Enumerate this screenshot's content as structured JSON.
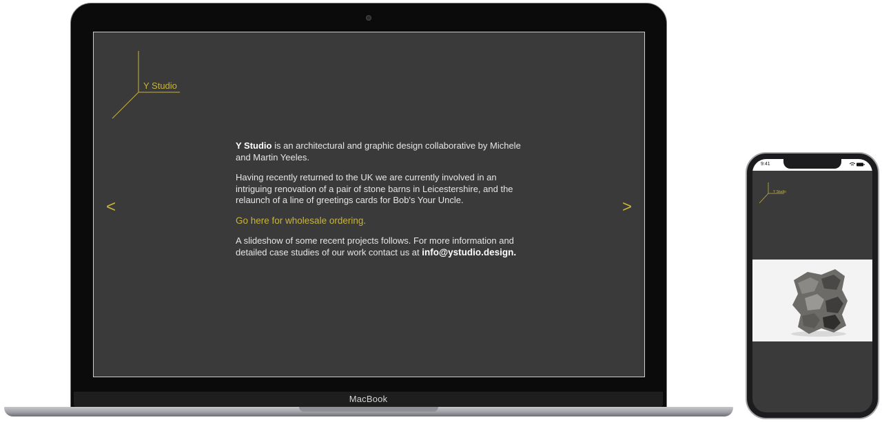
{
  "laptop": {
    "brand_label": "MacBook"
  },
  "site": {
    "logo_text": "Y Studio",
    "intro": {
      "brand": "Y Studio",
      "line1_rest": " is an architectural and graphic design collaborative by Michele and Martin Yeeles.",
      "para2": "Having recently returned to the UK we are currently involved in an intriguing renovation of a pair of stone barns in Leicestershire, and the relaunch of a line of greetings cards for Bob's Your Uncle.",
      "wholesale_link": "Go here for wholesale ordering.",
      "para4_text": "A slideshow of some recent projects follows. For more information and detailed case studies of our work contact us at ",
      "email": "info@ystudio.design."
    },
    "prev_arrow": "<",
    "next_arrow": ">",
    "accent_color": "#c8b43c",
    "background_color": "#3a3a3a"
  },
  "phone": {
    "time": "9:41",
    "status_icons": "wifi-icon battery-icon",
    "logo_text": "Y Studio",
    "photo_subject": "sculptural stacked wooden blocks"
  }
}
